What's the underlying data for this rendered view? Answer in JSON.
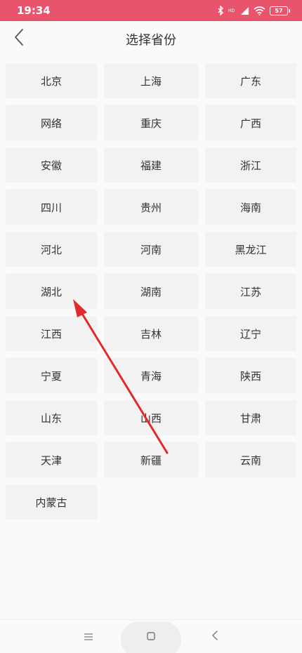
{
  "status_bar": {
    "time": "19:34",
    "battery": "57",
    "icons": [
      "bluetooth-icon",
      "hd-icon",
      "signal-icon",
      "wifi-icon",
      "battery-icon"
    ],
    "bg_color": "#e8546c"
  },
  "header": {
    "title": "选择省份",
    "back_icon": "chevron-left-icon"
  },
  "provinces": [
    "北京",
    "上海",
    "广东",
    "网络",
    "重庆",
    "广西",
    "安徽",
    "福建",
    "浙江",
    "四川",
    "贵州",
    "海南",
    "河北",
    "河南",
    "黑龙江",
    "湖北",
    "湖南",
    "江苏",
    "江西",
    "吉林",
    "辽宁",
    "宁夏",
    "青海",
    "陕西",
    "山东",
    "山西",
    "甘肃",
    "天津",
    "新疆",
    "云南",
    "内蒙古"
  ],
  "annotation": {
    "type": "red-arrow",
    "points_to": "湖北",
    "color": "#e02b2b"
  },
  "nav_bar": {
    "icons": [
      "menu-icon",
      "home-icon",
      "back-icon"
    ]
  }
}
